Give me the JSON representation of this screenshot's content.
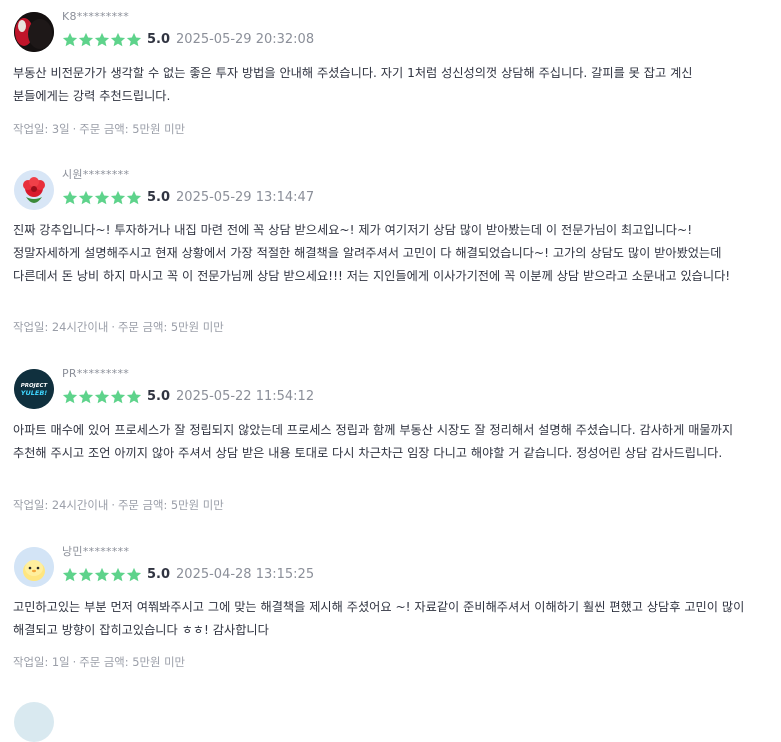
{
  "reviews": [
    {
      "nickname": "K8*********",
      "avatar": "dark-portrait-avatar",
      "score": "5.0",
      "stars": 5,
      "date": "2025-05-29 20:32:08",
      "text": "부동산 비전문가가 생각할 수 없는 좋은 투자 방법을 안내해 주셨습니다. 자기 1처럼 성신성의껏 상담해 주십니다. 갈피를 못 잡고 계신 분들에게는 강력 추천드립니다.",
      "work_time": "작업일: 3일",
      "order_amount": "주문 금액: 5만원 미만"
    },
    {
      "nickname": "시원********",
      "avatar": "red-flower-avatar",
      "score": "5.0",
      "stars": 5,
      "date": "2025-05-29 13:14:47",
      "text": "진짜 강추입니다~! 투자하거나 내집 마련 전에 꼭 상담 받으세요~! 제가 여기저기 상담 많이 받아봤는데 이 전문가님이 최고입니다~! 정말자세하게 설명해주시고 현재 상황에서 가장 적절한 해결책을 알려주셔서 고민이 다 해결되었습니다~! 고가의 상담도 많이 받아봤었는데 다른데서 돈 낭비 하지 마시고 꼭 이 전문가님께 상담 받으세요!!! 저는 지인들에게 이사가기전에 꼭 이분께 상담 받으라고 소문내고 있습니다!",
      "work_time": "작업일: 24시간이내",
      "order_amount": "주문 금액: 5만원 미만"
    },
    {
      "nickname": "PR*********",
      "avatar": "project-yuleb-logo-avatar",
      "avatar_text_top": "PROJECT",
      "avatar_text_bottom": "YULEB!",
      "score": "5.0",
      "stars": 5,
      "date": "2025-05-22 11:54:12",
      "text": "아파트 매수에 있어 프로세스가 잘 정립되지 않았는데 프로세스 정립과 함께 부동산 시장도 잘 정리해서 설명해 주셨습니다. 감사하게 매물까지 추천해 주시고 조언 아끼지 않아 주셔서 상담 받은 내용 토대로 다시 차근차근 임장 다니고 해야할 거 같습니다. 정성어린 상담 감사드립니다.",
      "work_time": "작업일: 24시간이내",
      "order_amount": "주문 금액: 5만원 미만"
    },
    {
      "nickname": "낭민********",
      "avatar": "yellow-chick-avatar",
      "score": "5.0",
      "stars": 5,
      "date": "2025-04-28 13:15:25",
      "text": "고민하고있는 부분 먼저 여쭤봐주시고 그에 맞는 해결책을 제시해 주셨어요 ~! 자료같이 준비해주셔서 이해하기 훨씬 편했고 상담후 고민이 많이 해결되고 방향이 잡히고있습니다 ㅎㅎ! 감사합니다",
      "work_time": "작업일: 1일",
      "order_amount": "주문 금액: 5만원 미만"
    }
  ],
  "colors": {
    "star": "#5ed38b",
    "text": "#303441",
    "muted": "#8b8f99"
  }
}
